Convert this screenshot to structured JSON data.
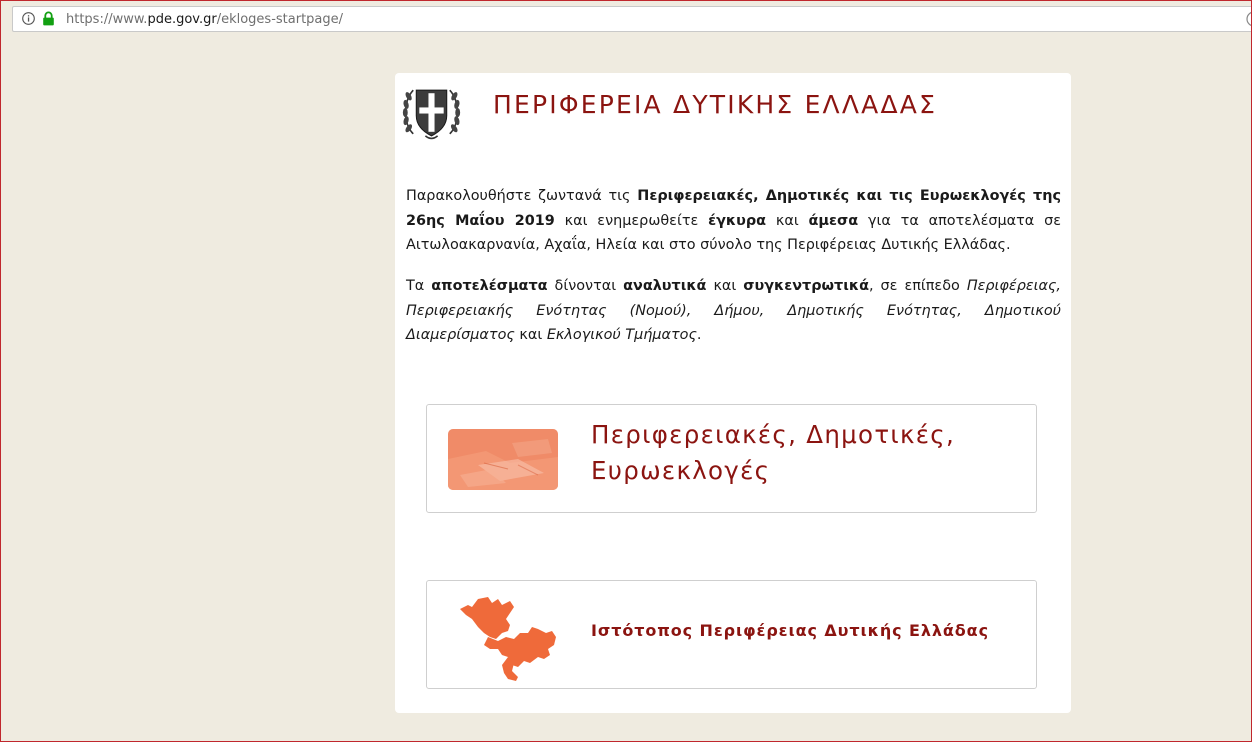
{
  "browser": {
    "url_prefix": "https://www.",
    "url_host": "pde.gov.gr",
    "url_path": "/ekloges-startpage/"
  },
  "header": {
    "title": "ΠΕΡΙΦΕΡΕΙΑ ΔΥΤΙΚΗΣ ΕΛΛΑΔΑΣ"
  },
  "intro": {
    "p1": [
      {
        "text": "Παρακολουθήστε ζωντανά τις ",
        "bold": false
      },
      {
        "text": "Περιφερειακές, Δημοτικές και τις Ευρωεκλογές της 26ης Μαΐου 2019",
        "bold": true
      },
      {
        "text": " και ενημερωθείτε ",
        "bold": false
      },
      {
        "text": "έγκυρα",
        "bold": true
      },
      {
        "text": " και ",
        "bold": false
      },
      {
        "text": "άμεσα",
        "bold": true
      },
      {
        "text": " για τα αποτελέσματα σε Αιτωλοακαρνανία, Αχαΐα, Ηλεία και στο σύνολο της Περιφέρειας Δυτικής Ελλάδας.",
        "bold": false
      }
    ],
    "p2": [
      {
        "text": "Τα ",
        "style": "normal"
      },
      {
        "text": "αποτελέσματα",
        "style": "bold"
      },
      {
        "text": " δίνονται ",
        "style": "normal"
      },
      {
        "text": "αναλυτικά",
        "style": "bold"
      },
      {
        "text": " και ",
        "style": "normal"
      },
      {
        "text": "συγκεντρωτικά",
        "style": "bold"
      },
      {
        "text": ", σε επίπεδο ",
        "style": "normal"
      },
      {
        "text": "Περιφέρειας, Περιφερειακής Ενότητας (Νομού), Δήμου, Δημοτικής Ενότητας, Δημοτικού Διαμερίσματος",
        "style": "italic"
      },
      {
        "text": " και ",
        "style": "normal"
      },
      {
        "text": "Εκλογικού Τμήματος",
        "style": "italic"
      },
      {
        "text": ".",
        "style": "normal"
      }
    ]
  },
  "links": {
    "elections_label": "Περιφερειακές, Δημοτικές, Ευρωεκλογές",
    "website_label": "Ιστότοπος Περιφέρειας Δυτικής Ελλάδας"
  },
  "colors": {
    "accent": "#8b1410",
    "map_orange": "#ef6a3a",
    "page_bg": "#efebe0"
  },
  "icons": {
    "site_info": "info-icon",
    "secure": "lock-icon",
    "emblem": "greek-coat-of-arms-icon",
    "elections": "ballot-photo-icon",
    "region": "region-map-icon"
  }
}
